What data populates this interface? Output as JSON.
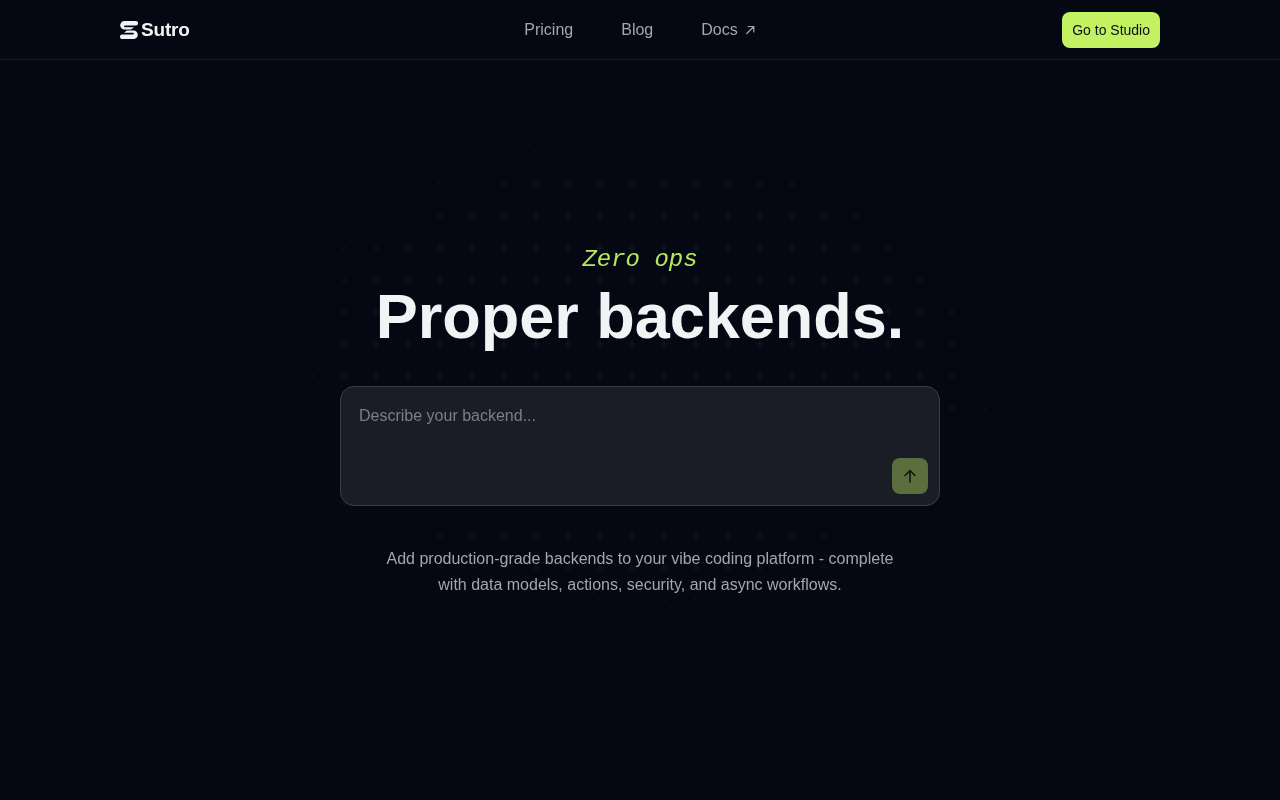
{
  "header": {
    "logo": {
      "text": "Sutro"
    },
    "nav": [
      {
        "label": "Pricing",
        "external": false
      },
      {
        "label": "Blog",
        "external": false
      },
      {
        "label": "Docs",
        "external": true
      }
    ],
    "cta": {
      "label": "Go to Studio"
    }
  },
  "hero": {
    "eyebrow": "Zero ops",
    "title": "Proper backends.",
    "prompt": {
      "placeholder": "Describe your backend...",
      "send_disabled": true
    },
    "description": "Add production-grade backends to your vibe coding platform - complete with data models, actions, security, and async workflows."
  }
}
